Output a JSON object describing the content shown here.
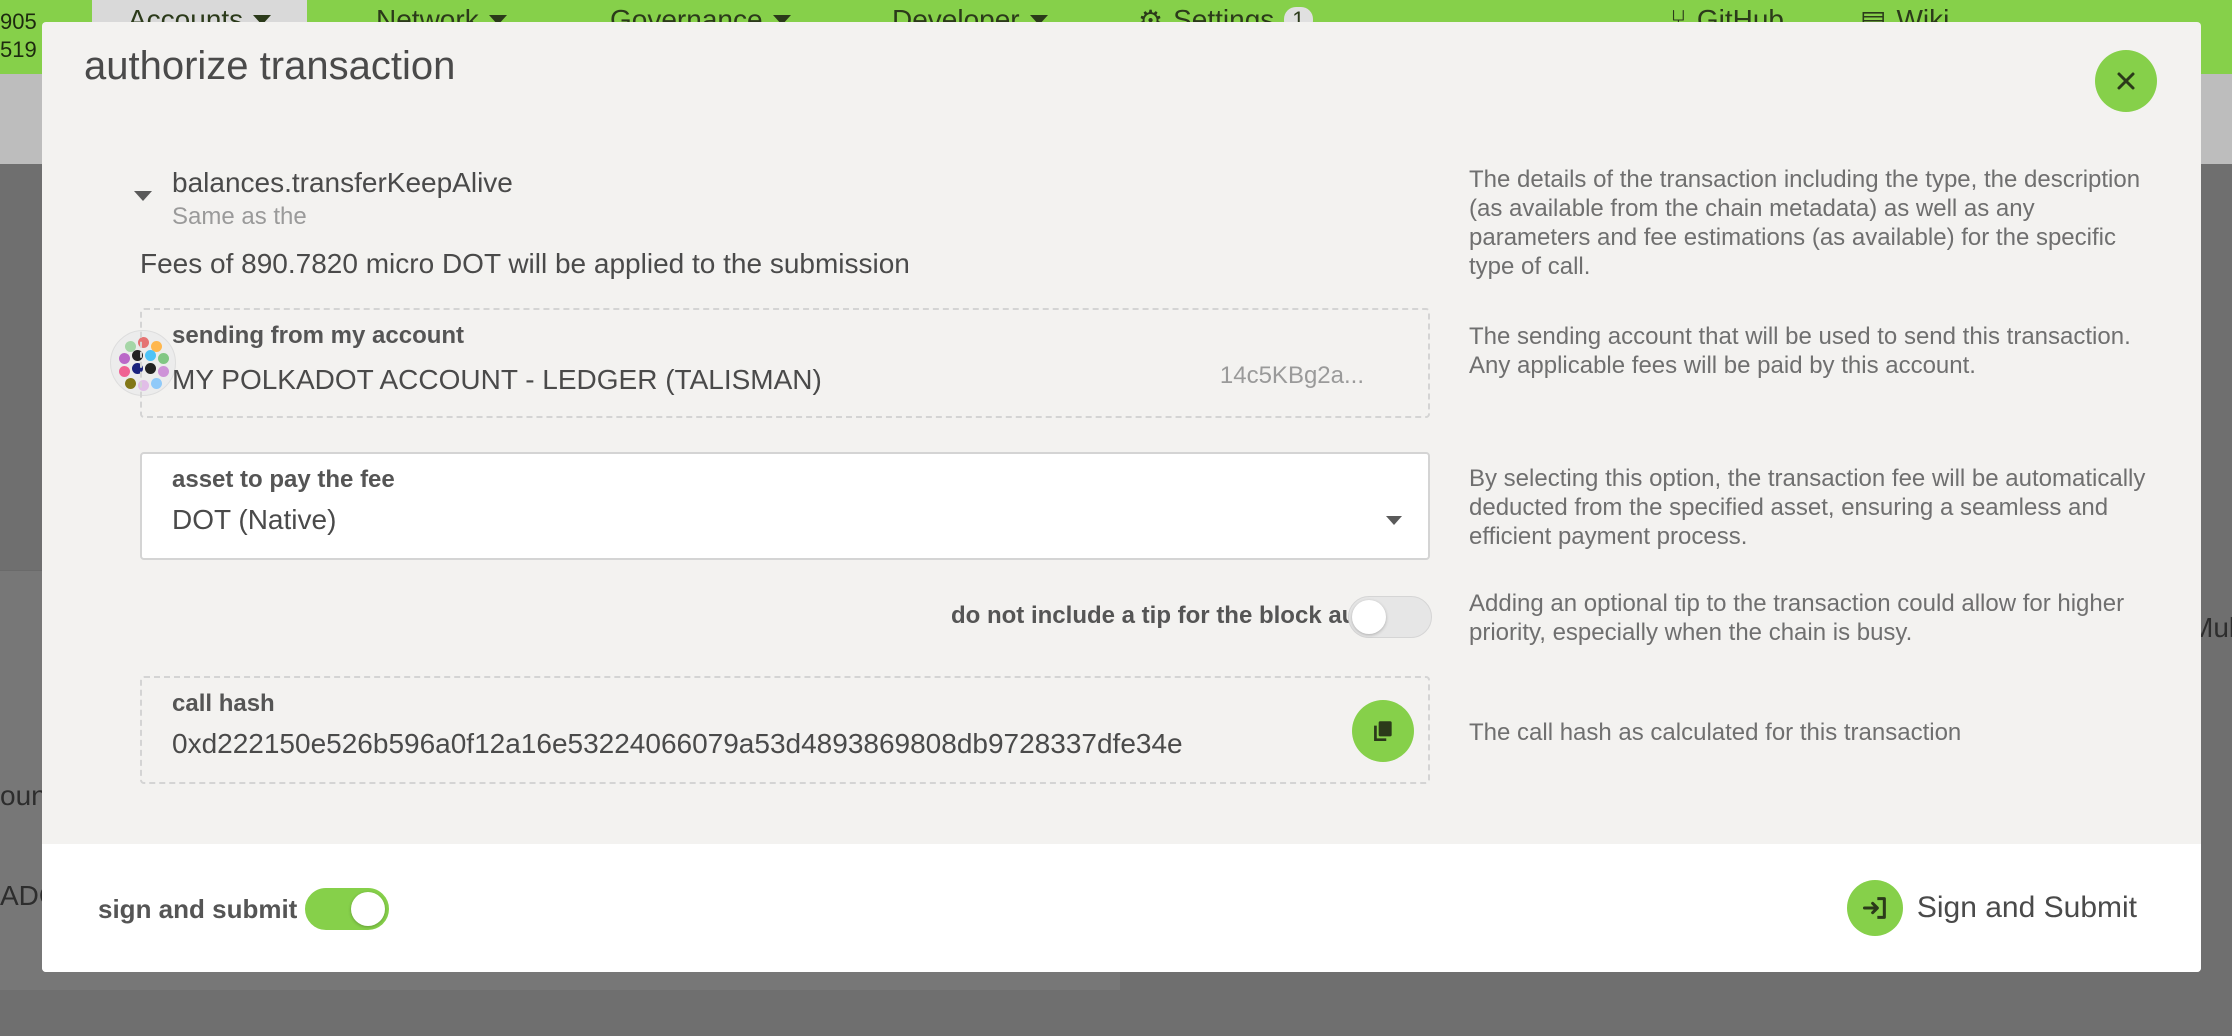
{
  "background": {
    "block_number_top": "905",
    "block_number_bottom": "519",
    "nav": {
      "accounts": "Accounts",
      "network": "Network",
      "governance": "Governance",
      "developer": "Developer",
      "settings": "Settings",
      "settings_badge": "1",
      "github": "GitHub",
      "wiki": "Wiki"
    },
    "fragments": {
      "left_text_1": "oun",
      "left_text_2": "ADC",
      "right_text": "Mul"
    }
  },
  "modal": {
    "title": "authorize transaction",
    "call": {
      "name": "balances.transferKeepAlive",
      "description": "Same as the"
    },
    "fees": "Fees of 890.7820 micro DOT will be applied to the submission",
    "sending_account": {
      "label": "sending from my account",
      "name": "MY POLKADOT ACCOUNT - LEDGER (TALISMAN)",
      "address": "14c5KBg2a..."
    },
    "fee_asset": {
      "label": "asset to pay the fee",
      "value": "DOT (Native)"
    },
    "tip": {
      "label": "do not include a tip for the block author",
      "enabled": false
    },
    "call_hash": {
      "label": "call hash",
      "value": "0xd222150e526b596a0f12a16e53224066079a53d4893869808db9728337dfe34e"
    },
    "help": {
      "details": "The details of the transaction including the type, the description (as available from the chain metadata) as well as any parameters and fee estimations (as available) for the specific type of call.",
      "sender": "The sending account that will be used to send this transaction. Any applicable fees will be paid by this account.",
      "fee_asset": "By selecting this option, the transaction fee will be automatically deducted from the specified asset, ensuring a seamless and efficient payment process.",
      "tip": "Adding an optional tip to the transaction could allow for higher priority, especially when the chain is busy.",
      "call_hash": "The call hash as calculated for this transaction"
    },
    "footer": {
      "sign_and_submit_label": "sign and submit",
      "sign_and_submit_enabled": true,
      "submit_button": "Sign and Submit"
    }
  },
  "colors": {
    "accent": "#86d04a",
    "modal_bg": "#f3f2f0",
    "overlay": "#7a7a7a"
  }
}
